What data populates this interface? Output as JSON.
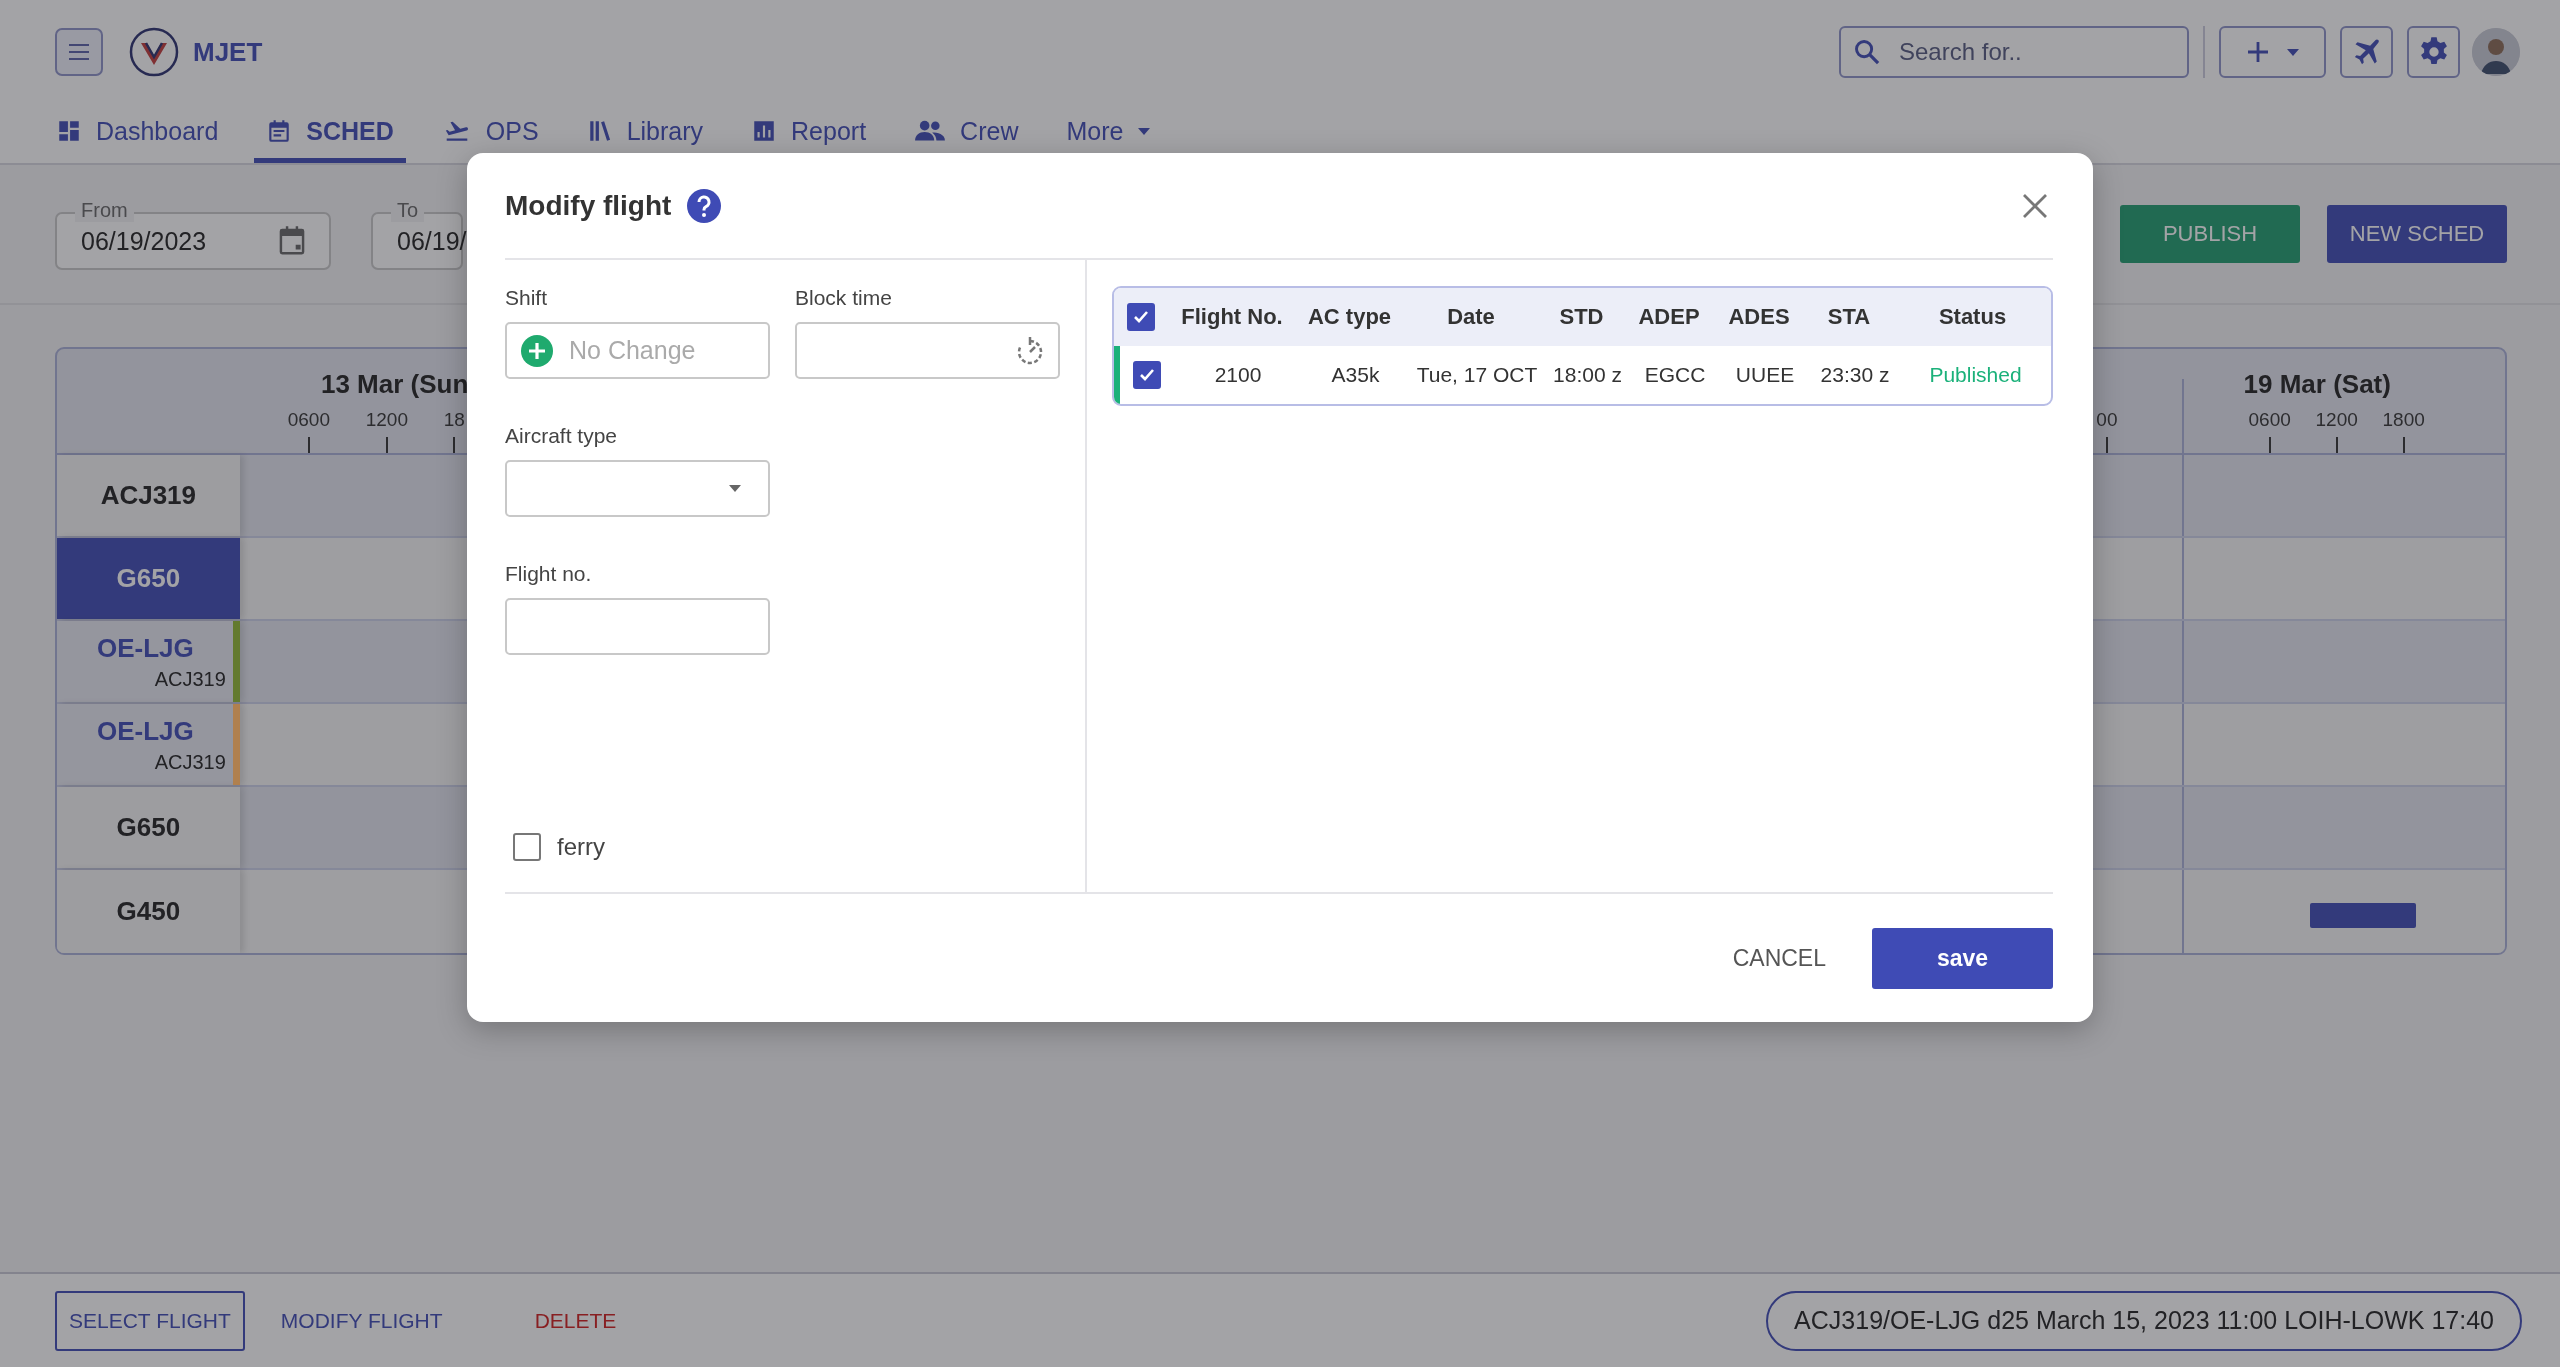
{
  "app": {
    "name": "MJET"
  },
  "search": {
    "placeholder": "Search for.."
  },
  "nav_tabs": [
    {
      "label": "Dashboard",
      "selected": false
    },
    {
      "label": "SCHED",
      "selected": true
    },
    {
      "label": "OPS",
      "selected": false
    },
    {
      "label": "Library",
      "selected": false
    },
    {
      "label": "Report",
      "selected": false
    },
    {
      "label": "Crew",
      "selected": false
    },
    {
      "label": "More",
      "selected": false
    }
  ],
  "date_range": {
    "from": {
      "label": "From",
      "value": "06/19/2023"
    },
    "to": {
      "label": "To",
      "value": "06/19/"
    }
  },
  "actions": [
    {
      "label": "PUBLISH",
      "kind": "success"
    },
    {
      "label": "NEW SCHED",
      "kind": "primary"
    }
  ],
  "schedule": {
    "days": [
      {
        "label": "13 Mar (Sun",
        "ticks": [
          "0600",
          "1200",
          "18"
        ]
      },
      {
        "ticks": [
          "00"
        ]
      },
      {
        "label": "19 Mar (Sat)",
        "ticks": [
          "0600",
          "1200",
          "1800"
        ]
      }
    ],
    "rows": [
      {
        "kind": "type",
        "label": "ACJ319",
        "selected": false
      },
      {
        "kind": "type",
        "label": "G650",
        "selected": true
      },
      {
        "kind": "aircraft",
        "label": "OE-LJG",
        "sublabel": "ACJ319",
        "color": "#637a2f"
      },
      {
        "kind": "aircraft",
        "label": "OE-LJG",
        "sublabel": "ACJ319",
        "color": "#b0804e"
      },
      {
        "kind": "type",
        "label": "G650",
        "selected": false
      },
      {
        "kind": "type",
        "label": "G450",
        "selected": false,
        "flight_bar": true
      }
    ]
  },
  "dialog": {
    "title": "Modify flight",
    "shift": {
      "label": "Shift",
      "placeholder": "No Change"
    },
    "block_time": {
      "label": "Block time"
    },
    "aircraft_type": {
      "label": "Aircraft type"
    },
    "flight_no": {
      "label": "Flight no."
    },
    "ferry": {
      "label": "ferry",
      "checked": false
    },
    "table": {
      "all_selected": true,
      "columns": [
        "Flight No.",
        "AC type",
        "Date",
        "STD",
        "ADEP",
        "ADES",
        "STA",
        "Status"
      ],
      "rows": [
        {
          "selected": true,
          "color": "#1bb17a",
          "cells": [
            "2100",
            "A35k",
            "Tue, 17 OCT",
            "18:00 z",
            "EGCC",
            "UUEE",
            "23:30 z",
            "Published"
          ]
        }
      ]
    },
    "buttons": [
      {
        "label": "CANCEL",
        "kind": "text"
      },
      {
        "label": "save",
        "kind": "primary"
      }
    ]
  },
  "bottom_bar": {
    "buttons": [
      {
        "label": "SELECT FLIGHT",
        "kind": "outlined"
      },
      {
        "label": "MODIFY FLIGHT",
        "kind": "text"
      },
      {
        "label": "DELETE",
        "kind": "danger"
      }
    ],
    "summary": "ACJ319/OE-LJG d25 March 15, 2023 11:00 LOIH-LOWK 17:40"
  }
}
